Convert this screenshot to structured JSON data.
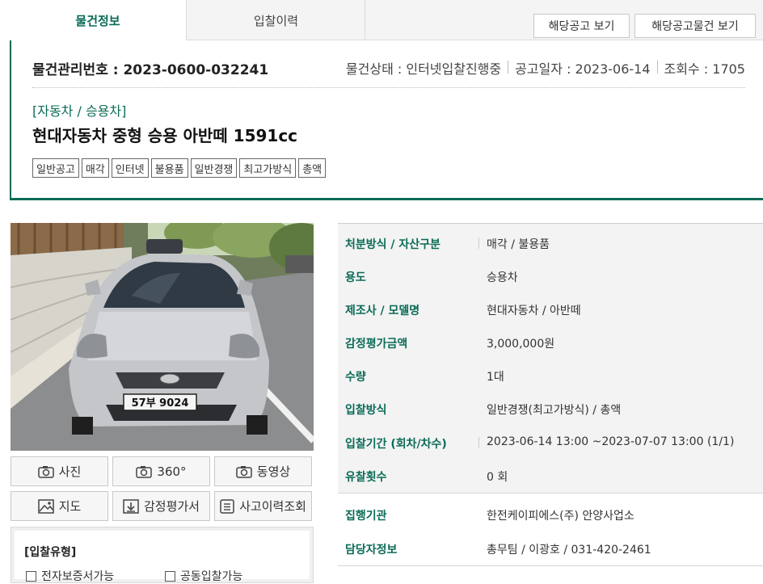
{
  "tabs": [
    {
      "label": "물건정보",
      "active": true
    },
    {
      "label": "입찰이력",
      "active": false
    }
  ],
  "top_buttons": [
    "해당공고 보기",
    "해당공고물건 보기"
  ],
  "header": {
    "mgmt_label": "물건관리번호 : 2023-0600-032241",
    "status": "물건상태 : 인터넷입찰진행중",
    "notice_date": "공고일자 : 2023-06-14",
    "views": "조회수 : 1705",
    "category": "[자동차 / 승용차]",
    "title": "현대자동차 중형 승용 아반떼 1591cc",
    "tags": [
      "일반공고",
      "매각",
      "인터넷",
      "불용품",
      "일반경쟁",
      "최고가방식",
      "총액"
    ]
  },
  "photo": {
    "plate": "57부 9024"
  },
  "media_buttons": [
    {
      "label": "사진",
      "icon": "camera-icon"
    },
    {
      "label": "360°",
      "icon": "camera-icon"
    },
    {
      "label": "동영상",
      "icon": "camera-icon"
    },
    {
      "label": "지도",
      "icon": "map-icon"
    },
    {
      "label": "감정평가서",
      "icon": "download-icon"
    },
    {
      "label": "사고이력조회",
      "icon": "document-icon"
    }
  ],
  "bid_type": {
    "title": "[입찰유형]",
    "options": [
      "전자보증서가능",
      "공동입찰가능"
    ]
  },
  "info": [
    {
      "key": "처분방식 / 자산구분",
      "value": "매각 / 불용품"
    },
    {
      "key": "용도",
      "value": "승용차"
    },
    {
      "key": "제조사 / 모델명",
      "value": "현대자동차 / 아반떼"
    },
    {
      "key": "감정평가금액",
      "value": "3,000,000원"
    },
    {
      "key": "수량",
      "value": "1대"
    },
    {
      "key": "입찰방식",
      "value": "일반경쟁(최고가방식) / 총액"
    },
    {
      "key": "입찰기간 (회차/차수)",
      "value": "2023-06-14 13:00 ~2023-07-07 13:00 (1/1)"
    },
    {
      "key": "유찰횟수",
      "value": "0 회"
    },
    {
      "key": "집행기관",
      "value": "한전케이피에스(주) 안양사업소"
    },
    {
      "key": "담당자정보",
      "value": "총무팀 / 이광호 / 031-420-2461"
    }
  ],
  "colors": {
    "accent": "#0b6b57"
  }
}
